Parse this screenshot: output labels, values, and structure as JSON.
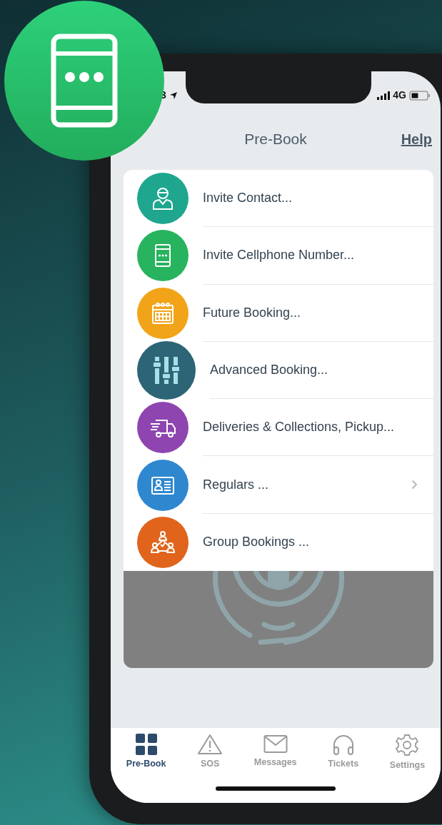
{
  "status_bar": {
    "time": "3",
    "network": "4G"
  },
  "nav_bar": {
    "title": "Pre-Book",
    "action": "Help"
  },
  "menu": [
    {
      "label": "Invite Contact...",
      "color": "#1ea68e",
      "kind": "standard",
      "chevron": false
    },
    {
      "label": "Invite Cellphone Number...",
      "color": "#28b35e",
      "kind": "standard",
      "chevron": false
    },
    {
      "label": "Future Booking...",
      "color": "#f2a418",
      "kind": "standard",
      "chevron": false
    },
    {
      "label": "Advanced Booking...",
      "color": "#2d6577",
      "kind": "large",
      "chevron": false
    },
    {
      "label": "Deliveries & Collections, Pickup...",
      "color": "#8f45b0",
      "kind": "standard",
      "chevron": false
    },
    {
      "label": "Regulars ...",
      "color": "#2f88cf",
      "kind": "standard",
      "chevron": true
    },
    {
      "label": "Group Bookings ...",
      "color": "#e0641c",
      "kind": "standard",
      "chevron": false
    }
  ],
  "tab_bar": [
    {
      "label": "Pre-Book",
      "selected": true
    },
    {
      "label": "SOS",
      "selected": false
    },
    {
      "label": "Messages",
      "selected": false
    },
    {
      "label": "Tickets",
      "selected": false
    },
    {
      "label": "Settings",
      "selected": false
    }
  ]
}
